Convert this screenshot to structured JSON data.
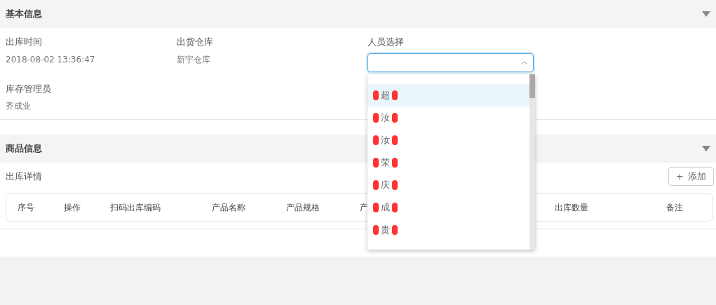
{
  "sections": [
    {
      "title": "基本信息",
      "expanded": true
    },
    {
      "title": "商品信息",
      "expanded": true
    }
  ],
  "basic_fields": [
    {
      "label": "出库时间",
      "value": "2018-08-02 13:36:47"
    },
    {
      "label": "出货仓库",
      "value": "新宇仓库"
    },
    {
      "label": "人员选择",
      "kind": "select",
      "open": true
    },
    {
      "label": "库存管理员",
      "value": "齐成业"
    }
  ],
  "dropdown_options": [
    {
      "label": "超",
      "selected": true
    },
    {
      "label": "汝",
      "selected": false
    },
    {
      "label": "汝",
      "selected": false
    },
    {
      "label": "荣",
      "selected": false
    },
    {
      "label": "庆",
      "selected": false
    },
    {
      "label": "成",
      "selected": false
    },
    {
      "label": "贵",
      "selected": false
    }
  ],
  "detail": {
    "title": "出库详情",
    "add_button": {
      "icon": "+",
      "label": "添加"
    }
  },
  "table": {
    "columns": [
      "序号",
      "操作",
      "扫码出库编码",
      "产品名称",
      "产品规格",
      "产",
      "出库数量",
      "备注"
    ]
  }
}
